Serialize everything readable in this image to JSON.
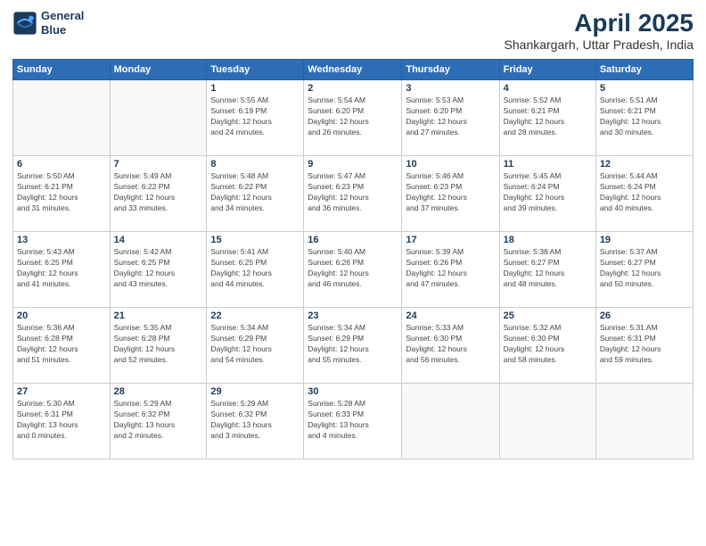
{
  "header": {
    "logo_line1": "General",
    "logo_line2": "Blue",
    "title": "April 2025",
    "subtitle": "Shankargarh, Uttar Pradesh, India"
  },
  "days_of_week": [
    "Sunday",
    "Monday",
    "Tuesday",
    "Wednesday",
    "Thursday",
    "Friday",
    "Saturday"
  ],
  "weeks": [
    [
      {
        "day": "",
        "info": ""
      },
      {
        "day": "",
        "info": ""
      },
      {
        "day": "1",
        "info": "Sunrise: 5:55 AM\nSunset: 6:19 PM\nDaylight: 12 hours\nand 24 minutes."
      },
      {
        "day": "2",
        "info": "Sunrise: 5:54 AM\nSunset: 6:20 PM\nDaylight: 12 hours\nand 26 minutes."
      },
      {
        "day": "3",
        "info": "Sunrise: 5:53 AM\nSunset: 6:20 PM\nDaylight: 12 hours\nand 27 minutes."
      },
      {
        "day": "4",
        "info": "Sunrise: 5:52 AM\nSunset: 6:21 PM\nDaylight: 12 hours\nand 28 minutes."
      },
      {
        "day": "5",
        "info": "Sunrise: 5:51 AM\nSunset: 6:21 PM\nDaylight: 12 hours\nand 30 minutes."
      }
    ],
    [
      {
        "day": "6",
        "info": "Sunrise: 5:50 AM\nSunset: 6:21 PM\nDaylight: 12 hours\nand 31 minutes."
      },
      {
        "day": "7",
        "info": "Sunrise: 5:49 AM\nSunset: 6:22 PM\nDaylight: 12 hours\nand 33 minutes."
      },
      {
        "day": "8",
        "info": "Sunrise: 5:48 AM\nSunset: 6:22 PM\nDaylight: 12 hours\nand 34 minutes."
      },
      {
        "day": "9",
        "info": "Sunrise: 5:47 AM\nSunset: 6:23 PM\nDaylight: 12 hours\nand 36 minutes."
      },
      {
        "day": "10",
        "info": "Sunrise: 5:46 AM\nSunset: 6:23 PM\nDaylight: 12 hours\nand 37 minutes."
      },
      {
        "day": "11",
        "info": "Sunrise: 5:45 AM\nSunset: 6:24 PM\nDaylight: 12 hours\nand 39 minutes."
      },
      {
        "day": "12",
        "info": "Sunrise: 5:44 AM\nSunset: 6:24 PM\nDaylight: 12 hours\nand 40 minutes."
      }
    ],
    [
      {
        "day": "13",
        "info": "Sunrise: 5:43 AM\nSunset: 6:25 PM\nDaylight: 12 hours\nand 41 minutes."
      },
      {
        "day": "14",
        "info": "Sunrise: 5:42 AM\nSunset: 6:25 PM\nDaylight: 12 hours\nand 43 minutes."
      },
      {
        "day": "15",
        "info": "Sunrise: 5:41 AM\nSunset: 6:25 PM\nDaylight: 12 hours\nand 44 minutes."
      },
      {
        "day": "16",
        "info": "Sunrise: 5:40 AM\nSunset: 6:26 PM\nDaylight: 12 hours\nand 46 minutes."
      },
      {
        "day": "17",
        "info": "Sunrise: 5:39 AM\nSunset: 6:26 PM\nDaylight: 12 hours\nand 47 minutes."
      },
      {
        "day": "18",
        "info": "Sunrise: 5:38 AM\nSunset: 6:27 PM\nDaylight: 12 hours\nand 48 minutes."
      },
      {
        "day": "19",
        "info": "Sunrise: 5:37 AM\nSunset: 6:27 PM\nDaylight: 12 hours\nand 50 minutes."
      }
    ],
    [
      {
        "day": "20",
        "info": "Sunrise: 5:36 AM\nSunset: 6:28 PM\nDaylight: 12 hours\nand 51 minutes."
      },
      {
        "day": "21",
        "info": "Sunrise: 5:35 AM\nSunset: 6:28 PM\nDaylight: 12 hours\nand 52 minutes."
      },
      {
        "day": "22",
        "info": "Sunrise: 5:34 AM\nSunset: 6:29 PM\nDaylight: 12 hours\nand 54 minutes."
      },
      {
        "day": "23",
        "info": "Sunrise: 5:34 AM\nSunset: 6:29 PM\nDaylight: 12 hours\nand 55 minutes."
      },
      {
        "day": "24",
        "info": "Sunrise: 5:33 AM\nSunset: 6:30 PM\nDaylight: 12 hours\nand 56 minutes."
      },
      {
        "day": "25",
        "info": "Sunrise: 5:32 AM\nSunset: 6:30 PM\nDaylight: 12 hours\nand 58 minutes."
      },
      {
        "day": "26",
        "info": "Sunrise: 5:31 AM\nSunset: 6:31 PM\nDaylight: 12 hours\nand 59 minutes."
      }
    ],
    [
      {
        "day": "27",
        "info": "Sunrise: 5:30 AM\nSunset: 6:31 PM\nDaylight: 13 hours\nand 0 minutes."
      },
      {
        "day": "28",
        "info": "Sunrise: 5:29 AM\nSunset: 6:32 PM\nDaylight: 13 hours\nand 2 minutes."
      },
      {
        "day": "29",
        "info": "Sunrise: 5:29 AM\nSunset: 6:32 PM\nDaylight: 13 hours\nand 3 minutes."
      },
      {
        "day": "30",
        "info": "Sunrise: 5:28 AM\nSunset: 6:33 PM\nDaylight: 13 hours\nand 4 minutes."
      },
      {
        "day": "",
        "info": ""
      },
      {
        "day": "",
        "info": ""
      },
      {
        "day": "",
        "info": ""
      }
    ]
  ]
}
